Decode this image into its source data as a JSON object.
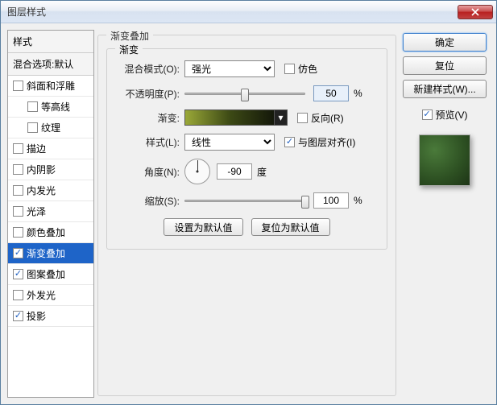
{
  "window": {
    "title": "图层样式"
  },
  "buttons": {
    "ok": "确定",
    "cancel": "复位",
    "new_style": "新建样式(W)...",
    "preview": "预览(V)",
    "close_icon": "close"
  },
  "styles_panel": {
    "header": "样式",
    "blend_defaults": "混合选项:默认",
    "items": [
      {
        "label": "斜面和浮雕",
        "checked": false,
        "indent": false
      },
      {
        "label": "等高线",
        "checked": false,
        "indent": true
      },
      {
        "label": "纹理",
        "checked": false,
        "indent": true
      },
      {
        "label": "描边",
        "checked": false,
        "indent": false
      },
      {
        "label": "内阴影",
        "checked": false,
        "indent": false
      },
      {
        "label": "内发光",
        "checked": false,
        "indent": false
      },
      {
        "label": "光泽",
        "checked": false,
        "indent": false
      },
      {
        "label": "颜色叠加",
        "checked": false,
        "indent": false
      },
      {
        "label": "渐变叠加",
        "checked": true,
        "indent": false,
        "selected": true
      },
      {
        "label": "图案叠加",
        "checked": true,
        "indent": false
      },
      {
        "label": "外发光",
        "checked": false,
        "indent": false
      },
      {
        "label": "投影",
        "checked": true,
        "indent": false
      }
    ]
  },
  "group": {
    "title": "渐变叠加",
    "inner_title": "渐变",
    "blend_mode_label": "混合模式(O):",
    "blend_mode_value": "强光",
    "dither_label": "仿色",
    "opacity_label": "不透明度(P):",
    "opacity_value": "50",
    "opacity_unit": "%",
    "gradient_label": "渐变:",
    "reverse_label": "反向(R)",
    "style_label": "样式(L):",
    "style_value": "线性",
    "align_label": "与图层对齐(I)",
    "angle_label": "角度(N):",
    "angle_value": "-90",
    "angle_unit": "度",
    "scale_label": "缩放(S):",
    "scale_value": "100",
    "scale_unit": "%",
    "reset_default": "设置为默认值",
    "restore_default": "复位为默认值"
  }
}
